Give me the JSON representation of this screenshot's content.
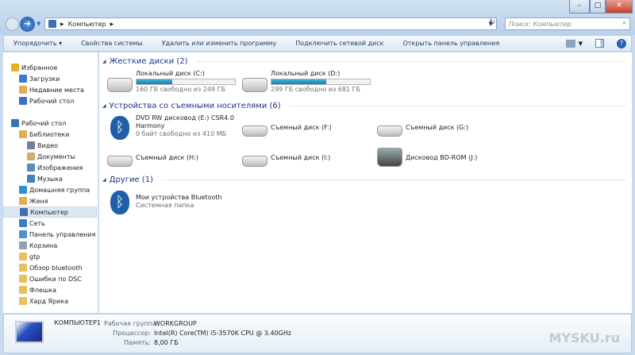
{
  "window": {
    "controls": [
      "minimize",
      "maximize",
      "close"
    ]
  },
  "address": {
    "path": "Компьютер",
    "search_placeholder": "Поиск: Компьютер"
  },
  "toolbar": {
    "organize": "Упорядочить",
    "items": [
      "Свойства системы",
      "Удалить или изменить программу",
      "Подключить сетевой диск",
      "Открыть панель управления"
    ]
  },
  "sidebar": {
    "items": [
      {
        "label": "Избранное",
        "icon": "star-icon",
        "color": "#e8b020"
      },
      {
        "label": "Загрузки",
        "icon": "downloads-icon",
        "color": "#3a7cc8"
      },
      {
        "label": "Недавние места",
        "icon": "recent-icon",
        "color": "#e0b050"
      },
      {
        "label": "Рабочий стол",
        "icon": "desktop-icon",
        "color": "#3a70c0"
      },
      {
        "label": "Рабочий стол",
        "icon": "desktop-icon",
        "color": "#3a70c0"
      },
      {
        "label": "Библиотеки",
        "icon": "library-icon",
        "color": "#e0b050"
      },
      {
        "label": "Видео",
        "icon": "video-icon",
        "color": "#7080a0"
      },
      {
        "label": "Документы",
        "icon": "documents-icon",
        "color": "#d0b070"
      },
      {
        "label": "Изображения",
        "icon": "pictures-icon",
        "color": "#5090c0"
      },
      {
        "label": "Музыка",
        "icon": "music-icon",
        "color": "#4080c0"
      },
      {
        "label": "Домашняя группа",
        "icon": "homegroup-icon",
        "color": "#3090d0"
      },
      {
        "label": "Женя",
        "icon": "user-folder-icon",
        "color": "#e0b050"
      },
      {
        "label": "Компьютер",
        "icon": "computer-icon",
        "color": "#4070b0",
        "selected": true
      },
      {
        "label": "Сеть",
        "icon": "network-icon",
        "color": "#3a80c8"
      },
      {
        "label": "Панель управления",
        "icon": "control-panel-icon",
        "color": "#5090d0"
      },
      {
        "label": "Корзина",
        "icon": "recycle-bin-icon",
        "color": "#90a0b0"
      },
      {
        "label": "gtp",
        "icon": "folder-icon",
        "color": "#e8c060"
      },
      {
        "label": "Обзор bluetooth",
        "icon": "folder-icon",
        "color": "#e8c060"
      },
      {
        "label": "Ошибки по DSC",
        "icon": "folder-icon",
        "color": "#e8c060"
      },
      {
        "label": "Флешка",
        "icon": "folder-icon",
        "color": "#e8c060"
      },
      {
        "label": "Хард Ярика",
        "icon": "folder-icon",
        "color": "#e8c060"
      }
    ]
  },
  "sections": {
    "hdd": {
      "title": "Жесткие диски (2)",
      "items": [
        {
          "name": "Локальный диск (C:)",
          "free": "160 ГБ свободно из 249 ГБ",
          "used_fraction": 0.36
        },
        {
          "name": "Локальный диск (D:)",
          "free": "299 ГБ свободно из 681 ГБ",
          "used_fraction": 0.56
        }
      ]
    },
    "removable": {
      "title": "Устройства со съемными носителями (6)",
      "items": [
        {
          "name": "DVD RW дисковод (E:) CSR4.0",
          "line2": "Harmony",
          "free": "0 байт свободно из 410 МБ"
        },
        {
          "name": "Съемный диск (F:)"
        },
        {
          "name": "Съемный диск (G:)"
        },
        {
          "name": "Съемный диск (H:)"
        },
        {
          "name": "Съемный диск (I:)"
        },
        {
          "name": "Дисковод BD-ROM (J:)"
        }
      ]
    },
    "other": {
      "title": "Другие (1)",
      "items": [
        {
          "name": "Мои устройства Bluetooth",
          "sub": "Системная папка"
        }
      ]
    }
  },
  "details": {
    "computer": "КОМПЬЮТЕР1",
    "workgroup_label": "Рабочая группа:",
    "workgroup": "WORKGROUP",
    "cpu_label": "Процессор:",
    "cpu": "Intel(R) Core(TM) i5-3570K CPU @ 3.40GHz",
    "ram_label": "Память:",
    "ram": "8,00 ГБ"
  },
  "watermark": "MYSKU.ru"
}
